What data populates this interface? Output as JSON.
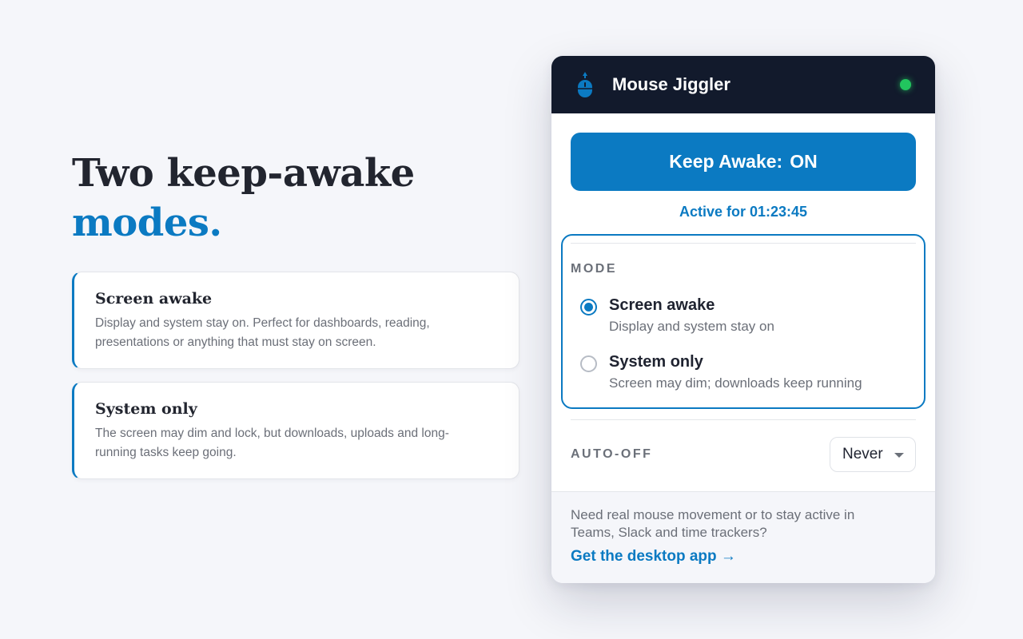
{
  "hero": {
    "title_line1": "Two keep-awake",
    "title_line2": "modes."
  },
  "features": [
    {
      "title": "Screen awake",
      "description": "Display and system stay on. Perfect for dashboards, reading, presentations or anything that must stay on screen."
    },
    {
      "title": "System only",
      "description": "The screen may dim and lock, but downloads, uploads and long-running tasks keep going."
    }
  ],
  "popup": {
    "app_title": "Mouse Jiggler",
    "logo_icon": "mouse-icon",
    "status": "active",
    "toggle": {
      "label": "Keep Awake:",
      "state": "ON"
    },
    "active_for": "Active for 01:23:45",
    "mode": {
      "label": "MODE",
      "options": [
        {
          "title": "Screen awake",
          "subtitle": "Display and system stay on",
          "selected": true
        },
        {
          "title": "System only",
          "subtitle": "Screen may dim; downloads keep running",
          "selected": false
        }
      ]
    },
    "auto_off": {
      "label": "AUTO-OFF",
      "selected": "Never"
    },
    "footer": {
      "text": "Need real mouse movement or to stay active in Teams, Slack and time trackers?",
      "link": "Get the desktop app →"
    }
  },
  "colors": {
    "accent": "#0b7ac2",
    "header_bg": "#121a2c",
    "status_green": "#22c55e",
    "page_bg": "#f5f6fa"
  }
}
